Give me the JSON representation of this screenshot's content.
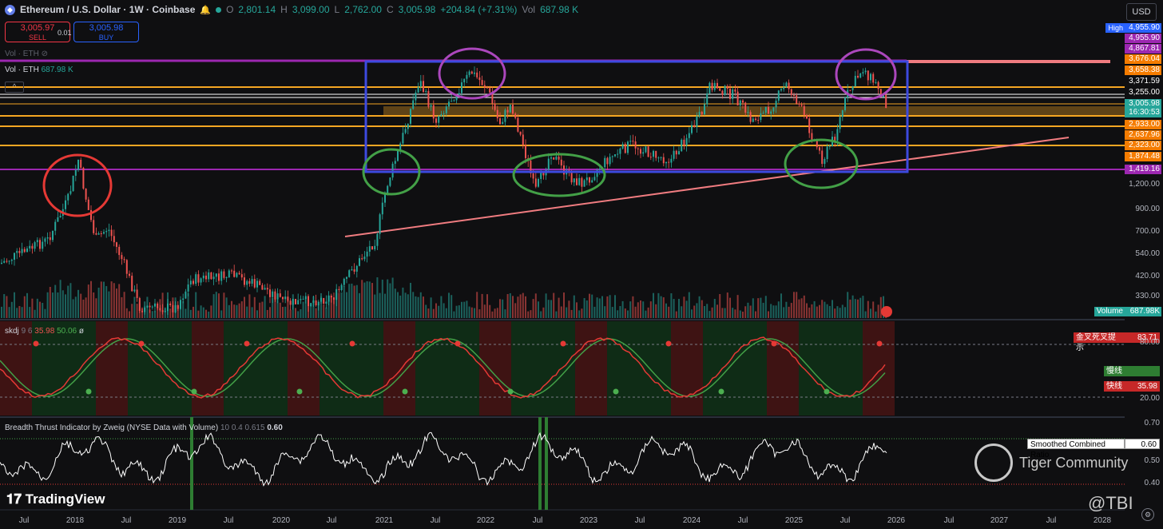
{
  "header": {
    "symbol": "Ethereum / U.S. Dollar · 1W · Coinbase",
    "open_k": "O",
    "open": "2,801.14",
    "high_k": "H",
    "high": "3,099.00",
    "low_k": "L",
    "low": "2,762.00",
    "close_k": "C",
    "close": "3,005.98",
    "change": "+204.84 (+7.31%)",
    "vol_k": "Vol",
    "vol": "687.98 K",
    "currency": "USD"
  },
  "trade": {
    "sell_price": "3,005.97",
    "sell_label": "SELL",
    "spread": "0.01",
    "buy_price": "3,005.98",
    "buy_label": "BUY"
  },
  "legend": {
    "vol_eth_hidden": "Vol · ETH",
    "vol_eth": "Vol · ETH",
    "vol_eth_value": "687.98 K"
  },
  "price_axis": {
    "high_label": "High",
    "high_value": "4,955.90",
    "levels": [
      "4,955.90",
      "4,867.81",
      "3,676.04",
      "3,658.38",
      "3,371.59",
      "3,255.00",
      "3,005.98",
      "16:30:53",
      "2,933.00",
      "2,637.96",
      "2,323.00",
      "1,874.48",
      "1,419.16"
    ],
    "level_colors": [
      "#9c27b0",
      "#9c27b0",
      "#f57c00",
      "#f57c00",
      "#0f0f11",
      "#0f0f11",
      "#26a69a",
      "#26a69a",
      "#f57c00",
      "#f57c00",
      "#f57c00",
      "#f57c00",
      "#9c27b0"
    ],
    "ticks": [
      "1,200.00",
      "900.00",
      "700.00",
      "540.00",
      "420.00",
      "330.00"
    ],
    "volume_label": "Volume",
    "volume_value": "687.98K"
  },
  "skdj": {
    "title": "skdj",
    "params": "9 6",
    "fast": "35.98",
    "slow": "50.06",
    "extra": "ø",
    "signal_label": "金叉死叉提示",
    "signal_value": "83.71",
    "slow_label": "慢线",
    "fast_label": "快线",
    "ticks": [
      "80.00",
      "60.00",
      "40.00",
      "20.00"
    ]
  },
  "breadth": {
    "title": "Breadth Thrust Indicator by Zweig (NYSE Data with Volume)",
    "params": "10 0.4 0.615",
    "value": "0.60",
    "ratio_label": "Smoothed Combined Ratio",
    "ratio_value": "0.60",
    "ticks": [
      "0.70",
      "0.50",
      "0.40"
    ]
  },
  "time_axis": [
    "Jul",
    "2018",
    "Jul",
    "2019",
    "Jul",
    "2020",
    "Jul",
    "2021",
    "Jul",
    "2022",
    "Jul",
    "2023",
    "Jul",
    "2024",
    "Jul",
    "2025",
    "Jul",
    "2026",
    "Jul",
    "2027",
    "Jul",
    "2028"
  ],
  "branding": {
    "tradingview": "TradingView",
    "community": "Tiger Community",
    "handle": "@TBI"
  },
  "colors": {
    "up": "#26a69a",
    "down": "#ef5350",
    "rect": "#3d4adf",
    "gold": "#f5a623",
    "trend": "#f07c80",
    "circle_red": "#e53935",
    "circle_green": "#43a047",
    "circle_purple": "#ab47bc"
  },
  "chart_data": [
    {
      "type": "line",
      "title": "Ethereum / U.S. Dollar · 1W · Coinbase",
      "y_scale": "log",
      "x": [
        "2017-07",
        "2018-01",
        "2018-07",
        "2019-01",
        "2019-07",
        "2020-01",
        "2020-07",
        "2021-01",
        "2021-07",
        "2022-01",
        "2022-07",
        "2023-01",
        "2023-07",
        "2024-01",
        "2024-07",
        "2025-01",
        "2025-07",
        "2025-10"
      ],
      "series": [
        {
          "values": [
            250,
            1400,
            450,
            110,
            280,
            130,
            230,
            730,
            2300,
            3700,
            1100,
            1200,
            1900,
            2300,
            3300,
            3300,
            2500,
            3006
          ]
        }
      ],
      "horizontal_levels": [
        4955.9,
        4867.81,
        3676.04,
        3658.38,
        3371.59,
        3255.0,
        2933.0,
        2637.96,
        2323.0,
        1874.48,
        1419.16
      ],
      "ylim": [
        300,
        5000
      ]
    },
    {
      "type": "line",
      "title": "skdj",
      "series": [
        {
          "name": "慢线",
          "values": [
            50.06
          ]
        },
        {
          "name": "快线",
          "values": [
            35.98
          ]
        }
      ],
      "ylim": [
        20,
        80
      ]
    },
    {
      "type": "line",
      "title": "Breadth Thrust Indicator by Zweig (NYSE Data with Volume)",
      "series": [
        {
          "name": "Smoothed Combined Ratio",
          "values": [
            0.6
          ]
        }
      ],
      "ylim": [
        0.4,
        0.7
      ]
    }
  ]
}
